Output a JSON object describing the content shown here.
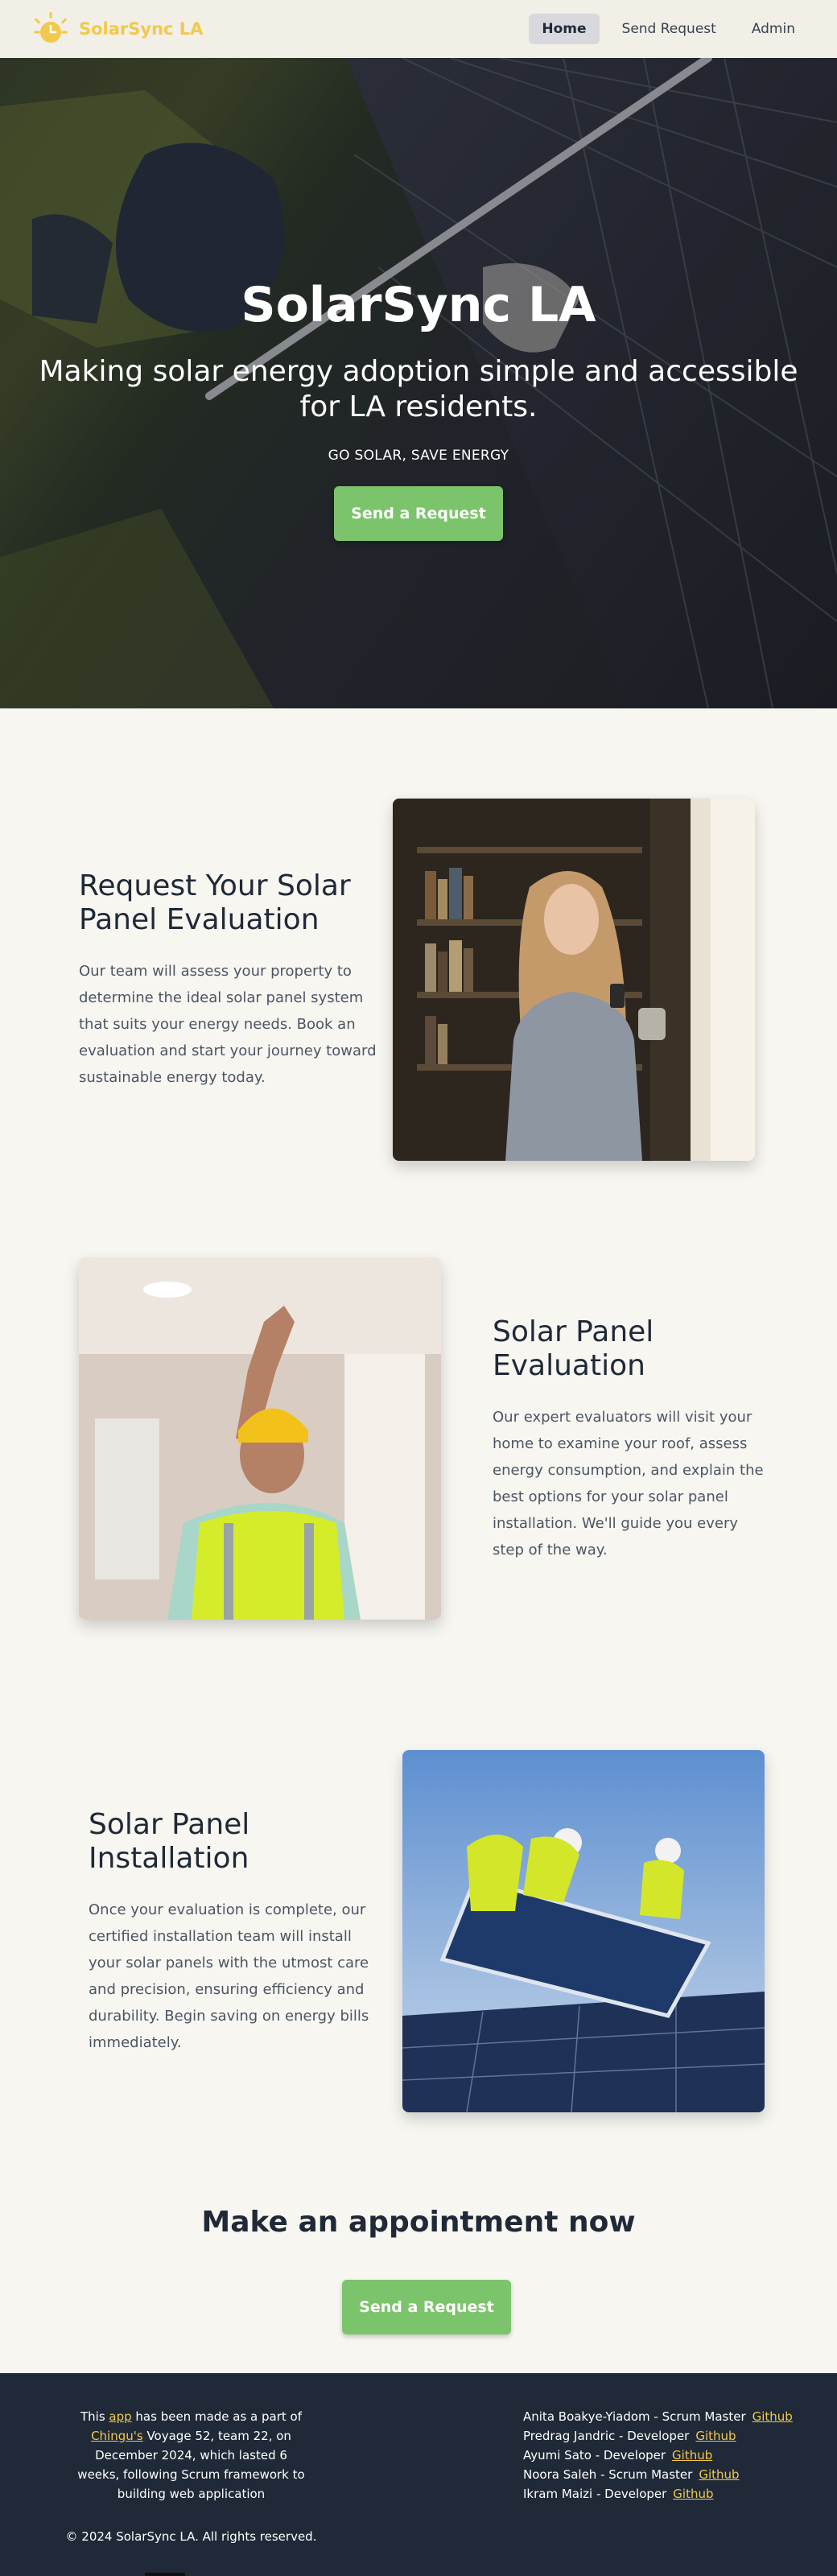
{
  "nav": {
    "brand": "SolarSync LA",
    "links": [
      {
        "label": "Home",
        "active": true
      },
      {
        "label": "Send Request",
        "active": false
      },
      {
        "label": "Admin",
        "active": false
      }
    ]
  },
  "hero": {
    "title": "SolarSync LA",
    "subtitle": "Making solar energy adoption simple and accessible for LA residents.",
    "tagline": "GO SOLAR, SAVE ENERGY",
    "button": "Send a Request"
  },
  "features": [
    {
      "title": "Request Your Solar Panel Evaluation",
      "text": "Our team will assess your property to determine the ideal solar panel system that suits your energy needs. Book an evaluation and start your journey toward sustainable energy today."
    },
    {
      "title": "Solar Panel Evaluation",
      "text": "Our expert evaluators will visit your home to examine your roof, assess energy consumption, and explain the best options for your solar panel installation. We'll guide you every step of the way."
    },
    {
      "title": "Solar Panel Installation",
      "text": "Once your evaluation is complete, our certified installation team will install your solar panels with the utmost care and precision, ensuring efficiency and durability. Begin saving on energy bills immediately."
    }
  ],
  "cta": {
    "title": "Make an appointment now",
    "button": "Send a Request"
  },
  "footer": {
    "about_pre": "This ",
    "about_app": "app",
    "about_mid": " has been made as a part of ",
    "about_chingu": "Chingu's",
    "about_post": " Voyage 52, team 22, on December 2024, which lasted 6 weeks, following Scrum framework to building web application",
    "copyright": "© 2024 SolarSync LA. All rights reserved.",
    "github_label": "Github",
    "team": [
      "Anita Boakye-Yiadom - Scrum Master",
      "Predrag Jandric - Developer",
      "Ayumi Sato - Developer",
      "Noora Saleh - Scrum Master",
      "Ikram Maizi - Developer"
    ]
  },
  "colors": {
    "brand_yellow": "#f2c94c",
    "button_green": "#7cc46b",
    "footer_bg": "#1f2937",
    "page_bg": "#f7f6f1"
  }
}
